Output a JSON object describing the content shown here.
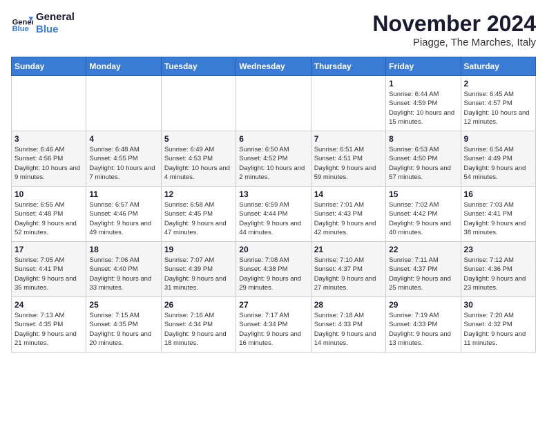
{
  "header": {
    "logo_text_general": "General",
    "logo_text_blue": "Blue",
    "month_title": "November 2024",
    "location": "Piagge, The Marches, Italy"
  },
  "days_of_week": [
    "Sunday",
    "Monday",
    "Tuesday",
    "Wednesday",
    "Thursday",
    "Friday",
    "Saturday"
  ],
  "weeks": [
    [
      {
        "day": "",
        "info": ""
      },
      {
        "day": "",
        "info": ""
      },
      {
        "day": "",
        "info": ""
      },
      {
        "day": "",
        "info": ""
      },
      {
        "day": "",
        "info": ""
      },
      {
        "day": "1",
        "info": "Sunrise: 6:44 AM\nSunset: 4:59 PM\nDaylight: 10 hours and 15 minutes."
      },
      {
        "day": "2",
        "info": "Sunrise: 6:45 AM\nSunset: 4:57 PM\nDaylight: 10 hours and 12 minutes."
      }
    ],
    [
      {
        "day": "3",
        "info": "Sunrise: 6:46 AM\nSunset: 4:56 PM\nDaylight: 10 hours and 9 minutes."
      },
      {
        "day": "4",
        "info": "Sunrise: 6:48 AM\nSunset: 4:55 PM\nDaylight: 10 hours and 7 minutes."
      },
      {
        "day": "5",
        "info": "Sunrise: 6:49 AM\nSunset: 4:53 PM\nDaylight: 10 hours and 4 minutes."
      },
      {
        "day": "6",
        "info": "Sunrise: 6:50 AM\nSunset: 4:52 PM\nDaylight: 10 hours and 2 minutes."
      },
      {
        "day": "7",
        "info": "Sunrise: 6:51 AM\nSunset: 4:51 PM\nDaylight: 9 hours and 59 minutes."
      },
      {
        "day": "8",
        "info": "Sunrise: 6:53 AM\nSunset: 4:50 PM\nDaylight: 9 hours and 57 minutes."
      },
      {
        "day": "9",
        "info": "Sunrise: 6:54 AM\nSunset: 4:49 PM\nDaylight: 9 hours and 54 minutes."
      }
    ],
    [
      {
        "day": "10",
        "info": "Sunrise: 6:55 AM\nSunset: 4:48 PM\nDaylight: 9 hours and 52 minutes."
      },
      {
        "day": "11",
        "info": "Sunrise: 6:57 AM\nSunset: 4:46 PM\nDaylight: 9 hours and 49 minutes."
      },
      {
        "day": "12",
        "info": "Sunrise: 6:58 AM\nSunset: 4:45 PM\nDaylight: 9 hours and 47 minutes."
      },
      {
        "day": "13",
        "info": "Sunrise: 6:59 AM\nSunset: 4:44 PM\nDaylight: 9 hours and 44 minutes."
      },
      {
        "day": "14",
        "info": "Sunrise: 7:01 AM\nSunset: 4:43 PM\nDaylight: 9 hours and 42 minutes."
      },
      {
        "day": "15",
        "info": "Sunrise: 7:02 AM\nSunset: 4:42 PM\nDaylight: 9 hours and 40 minutes."
      },
      {
        "day": "16",
        "info": "Sunrise: 7:03 AM\nSunset: 4:41 PM\nDaylight: 9 hours and 38 minutes."
      }
    ],
    [
      {
        "day": "17",
        "info": "Sunrise: 7:05 AM\nSunset: 4:41 PM\nDaylight: 9 hours and 35 minutes."
      },
      {
        "day": "18",
        "info": "Sunrise: 7:06 AM\nSunset: 4:40 PM\nDaylight: 9 hours and 33 minutes."
      },
      {
        "day": "19",
        "info": "Sunrise: 7:07 AM\nSunset: 4:39 PM\nDaylight: 9 hours and 31 minutes."
      },
      {
        "day": "20",
        "info": "Sunrise: 7:08 AM\nSunset: 4:38 PM\nDaylight: 9 hours and 29 minutes."
      },
      {
        "day": "21",
        "info": "Sunrise: 7:10 AM\nSunset: 4:37 PM\nDaylight: 9 hours and 27 minutes."
      },
      {
        "day": "22",
        "info": "Sunrise: 7:11 AM\nSunset: 4:37 PM\nDaylight: 9 hours and 25 minutes."
      },
      {
        "day": "23",
        "info": "Sunrise: 7:12 AM\nSunset: 4:36 PM\nDaylight: 9 hours and 23 minutes."
      }
    ],
    [
      {
        "day": "24",
        "info": "Sunrise: 7:13 AM\nSunset: 4:35 PM\nDaylight: 9 hours and 21 minutes."
      },
      {
        "day": "25",
        "info": "Sunrise: 7:15 AM\nSunset: 4:35 PM\nDaylight: 9 hours and 20 minutes."
      },
      {
        "day": "26",
        "info": "Sunrise: 7:16 AM\nSunset: 4:34 PM\nDaylight: 9 hours and 18 minutes."
      },
      {
        "day": "27",
        "info": "Sunrise: 7:17 AM\nSunset: 4:34 PM\nDaylight: 9 hours and 16 minutes."
      },
      {
        "day": "28",
        "info": "Sunrise: 7:18 AM\nSunset: 4:33 PM\nDaylight: 9 hours and 14 minutes."
      },
      {
        "day": "29",
        "info": "Sunrise: 7:19 AM\nSunset: 4:33 PM\nDaylight: 9 hours and 13 minutes."
      },
      {
        "day": "30",
        "info": "Sunrise: 7:20 AM\nSunset: 4:32 PM\nDaylight: 9 hours and 11 minutes."
      }
    ]
  ]
}
